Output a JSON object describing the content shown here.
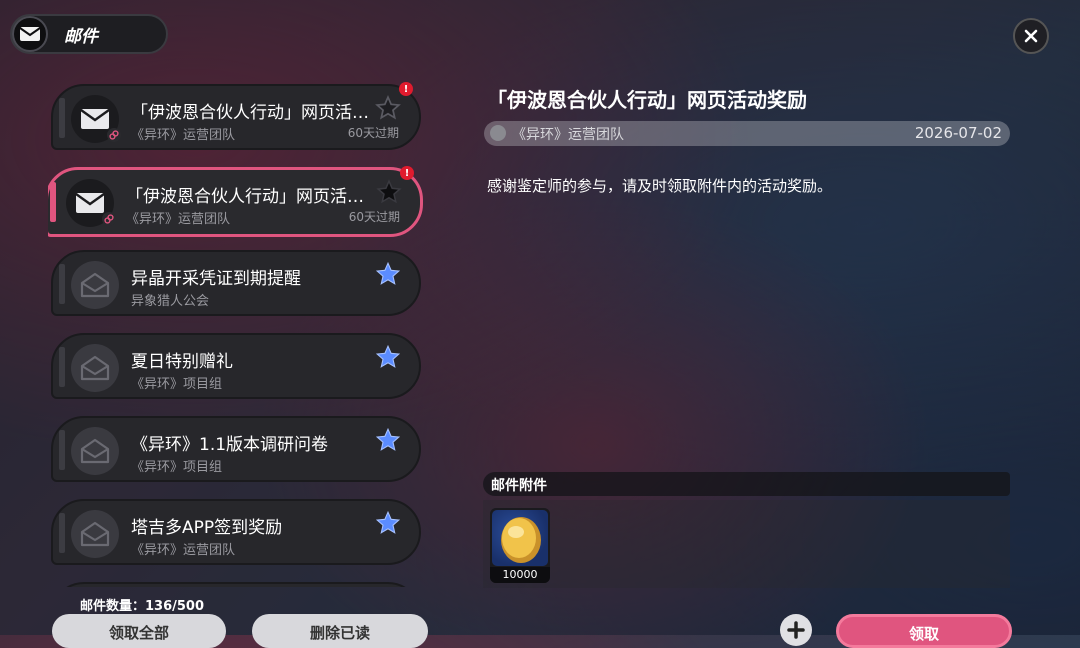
{
  "header": {
    "title": "邮件",
    "icon": "mail-icon"
  },
  "mails": [
    {
      "title": "「伊波恩合伙人行动」网页活…",
      "sender": "《异环》运营团队",
      "expiry": "60天过期",
      "read": false,
      "has_link": true,
      "alert": "!",
      "star": "empty"
    },
    {
      "title": "「伊波恩合伙人行动」网页活…",
      "sender": "《异环》运营团队",
      "expiry": "60天过期",
      "read": false,
      "has_link": true,
      "alert": "!",
      "star": "dark",
      "selected": true
    },
    {
      "title": "异晶开采凭证到期提醒",
      "sender": "异象猎人公会",
      "expiry": "",
      "read": true,
      "star": "blue"
    },
    {
      "title": "夏日特别赠礼",
      "sender": "《异环》项目组",
      "expiry": "",
      "read": true,
      "star": "blue"
    },
    {
      "title": "《异环》1.1版本调研问卷",
      "sender": "《异环》项目组",
      "expiry": "",
      "read": true,
      "star": "blue"
    },
    {
      "title": "塔吉多APP签到奖励",
      "sender": "《异环》运营团队",
      "expiry": "",
      "read": true,
      "star": "blue"
    }
  ],
  "footer": {
    "count": "邮件数量：136/500",
    "claim_all": "领取全部",
    "delete_read": "删除已读"
  },
  "detail": {
    "title": "「伊波恩合伙人行动」网页活动奖励",
    "sender": "《异环》运营团队",
    "date": "2026-07-02",
    "body": "感谢鉴定师的参与，请及时领取附件内的活动奖励。",
    "attach_header": "邮件附件",
    "attachments": [
      {
        "quantity": "10000",
        "icon": "gold-coin-icon"
      }
    ],
    "claim": "领取"
  },
  "colors": {
    "accent": "#e0557f",
    "alert": "#e01b2e",
    "star_blue": "#5b8cff"
  }
}
